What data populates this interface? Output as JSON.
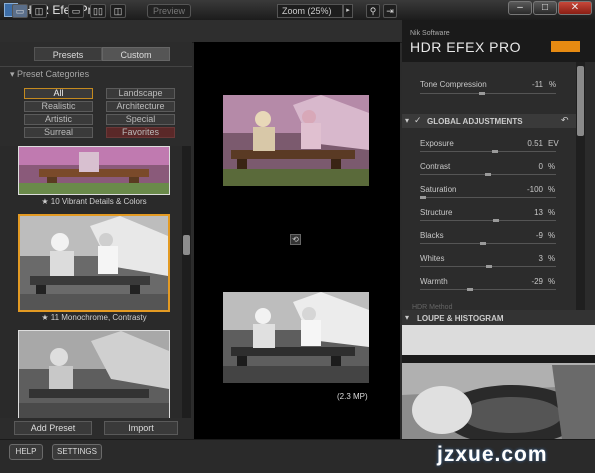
{
  "window": {
    "title": "HDR Efex Pro",
    "min_label": "–",
    "max_label": "□",
    "close_label": "✕"
  },
  "toolbar": {
    "preview_label": "Preview",
    "zoom_label": "Zoom (25%)",
    "zoom_arrow": "▸"
  },
  "left": {
    "tabs": [
      {
        "label": "Presets"
      },
      {
        "label": "Custom"
      }
    ],
    "category_header": "Preset Categories",
    "categories": [
      {
        "label": "All"
      },
      {
        "label": "Landscape"
      },
      {
        "label": "Realistic"
      },
      {
        "label": "Architecture"
      },
      {
        "label": "Artistic"
      },
      {
        "label": "Special"
      },
      {
        "label": "Surreal"
      },
      {
        "label": "Favorites"
      }
    ],
    "presets": [
      {
        "caption": "★ 10 Vibrant Details & Colors"
      },
      {
        "caption": "★ 11 Monochrome, Contrasty"
      }
    ],
    "add_preset_label": "Add Preset",
    "import_label": "Import"
  },
  "center": {
    "megapixels_label": "(2.3 MP)",
    "sync_icon": "sync-icon"
  },
  "right": {
    "brand": "Nik Software",
    "app_name": "HDR EFEX PRO",
    "logo_text": "nik Software",
    "tone_compression": {
      "label": "Tone Compression",
      "value": "-11",
      "unit": "%",
      "level": 0.45
    },
    "global_header": "GLOBAL ADJUSTMENTS",
    "adjustments": [
      {
        "label": "Exposure",
        "value": "0.51",
        "unit": "EV",
        "level": 0.55
      },
      {
        "label": "Contrast",
        "value": "0",
        "unit": "%",
        "level": 0.5
      },
      {
        "label": "Saturation",
        "value": "-100",
        "unit": "%",
        "level": 0.0
      },
      {
        "label": "Structure",
        "value": "13",
        "unit": "%",
        "level": 0.56
      },
      {
        "label": "Blacks",
        "value": "-9",
        "unit": "%",
        "level": 0.46
      },
      {
        "label": "Whites",
        "value": "3",
        "unit": "%",
        "level": 0.51
      },
      {
        "label": "Warmth",
        "value": "-29",
        "unit": "%",
        "level": 0.36
      }
    ],
    "hdr_method_label": "HDR Method",
    "loupe_header": "LOUPE & HISTOGRAM"
  },
  "footer": {
    "help_label": "HELP",
    "settings_label": "SETTINGS"
  },
  "watermark": {
    "text": "jzxue.com"
  },
  "colors": {
    "accent": "#e39a23",
    "favorites": "#5a2828",
    "selected_tab": "#5b6f8a"
  }
}
